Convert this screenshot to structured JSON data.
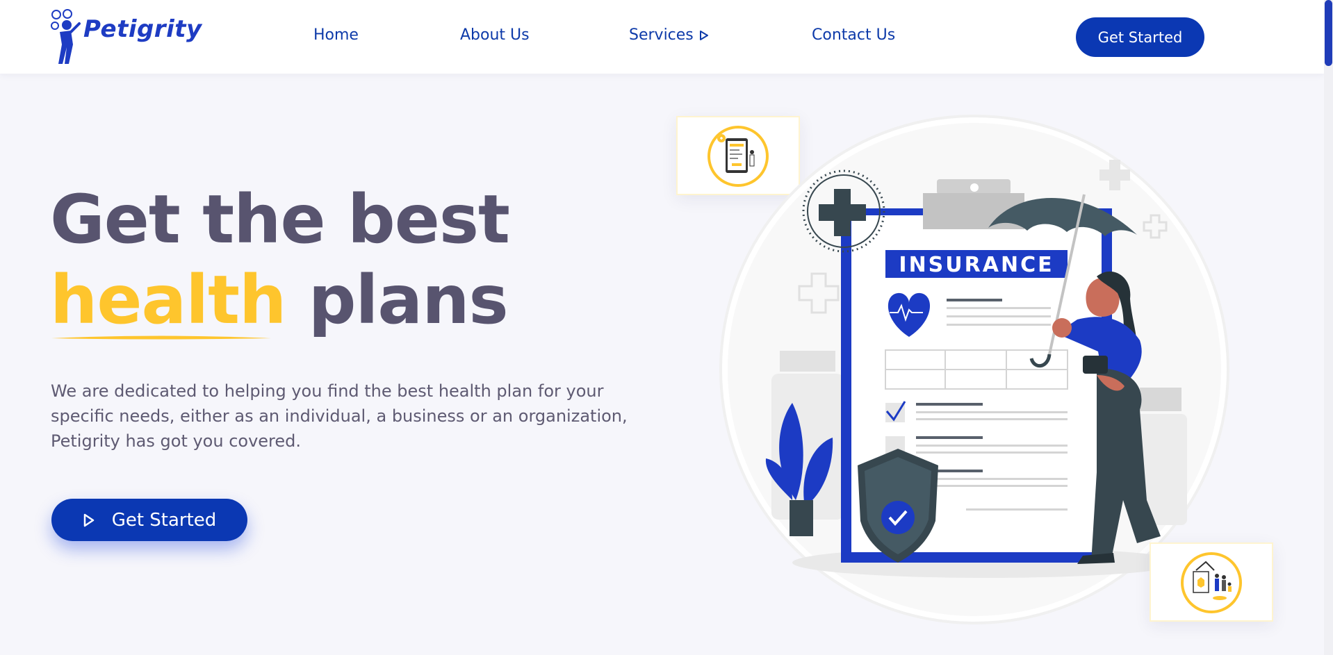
{
  "brand": {
    "name": "Petigrity",
    "primary_color": "#0b38b3",
    "accent_color": "#fec52d"
  },
  "nav": {
    "home": "Home",
    "about": "About Us",
    "services": "Services",
    "contact": "Contact Us",
    "cta": "Get Started"
  },
  "hero": {
    "title_line1": "Get the best",
    "title_highlight": "health",
    "title_rest": "plans",
    "description": "We are dedicated to helping you find the best health plan for your specific needs, either as an individual, a business or an organization, Petigrity has got you covered.",
    "cta": "Get Started"
  },
  "illustration": {
    "clipboard_label": "INSURANCE"
  },
  "icons": [
    "logo-icon",
    "play-icon",
    "triangle-right-icon",
    "check-icon",
    "heart-icon",
    "shield-icon",
    "umbrella-icon",
    "medical-cross-icon"
  ]
}
